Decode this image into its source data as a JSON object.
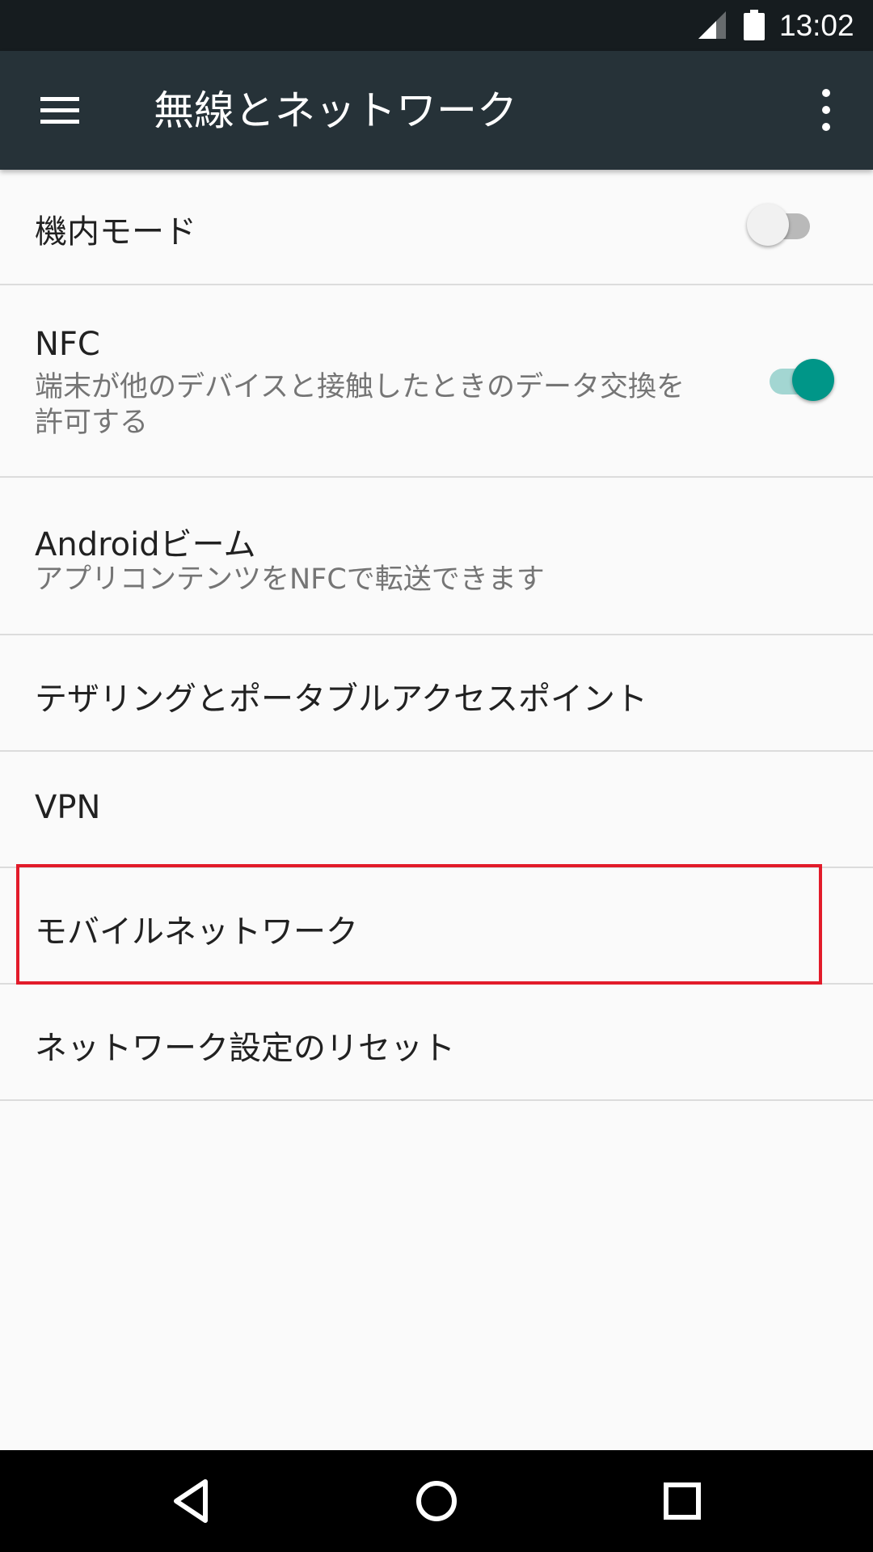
{
  "status_bar": {
    "time": "13:02",
    "icons": [
      "signal-icon",
      "battery-icon"
    ]
  },
  "toolbar": {
    "title": "無線とネットワーク",
    "icons": [
      "menu-icon",
      "overflow-menu-icon"
    ]
  },
  "settings": {
    "airplane_mode": {
      "title": "機内モード",
      "toggle_on": false
    },
    "nfc": {
      "title": "NFC",
      "summary": "端末が他のデバイスと接触したときのデータ交換を許可する",
      "toggle_on": true
    },
    "android_beam": {
      "title": "Androidビーム",
      "summary": "アプリコンテンツをNFCで転送できます"
    },
    "tethering": {
      "title": "テザリングとポータブルアクセスポイント"
    },
    "vpn": {
      "title": "VPN"
    },
    "mobile_network": {
      "title": "モバイルネットワーク",
      "highlighted": true
    },
    "network_reset": {
      "title": "ネットワーク設定のリセット"
    }
  },
  "colors": {
    "status_bar": "#161c1f",
    "toolbar": "#263238",
    "accent": "#009688",
    "highlight": "#e21b2a",
    "background": "#fafafa"
  },
  "nav_bar": {
    "icons": [
      "back-icon",
      "home-icon",
      "recents-icon"
    ]
  }
}
